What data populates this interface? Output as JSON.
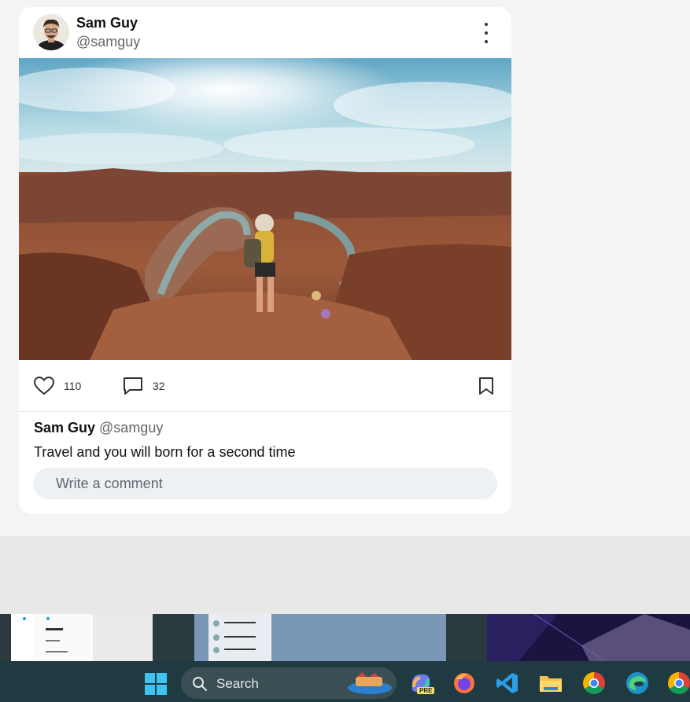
{
  "post": {
    "author_name": "Sam Guy",
    "author_handle": "@samguy",
    "likes": "110",
    "comments": "32",
    "caption_name": "Sam Guy",
    "caption_handle": "@samguy",
    "caption": "Travel and you will born for a second time",
    "comment_placeholder": "Write a comment"
  },
  "taskbar": {
    "search_label": "Search",
    "copilot_badge": "PRE",
    "icons": [
      "windows-start-icon",
      "search-icon",
      "copilot-icon",
      "firefox-icon",
      "vscode-icon",
      "file-explorer-icon",
      "chrome-icon",
      "edge-icon",
      "chrome-profile-icon"
    ]
  },
  "colors": {
    "card_bg": "#ffffff",
    "page_bg": "#f4f4f4",
    "taskbar_bg": "#1f3a40",
    "comment_bg": "#eef1f3"
  }
}
